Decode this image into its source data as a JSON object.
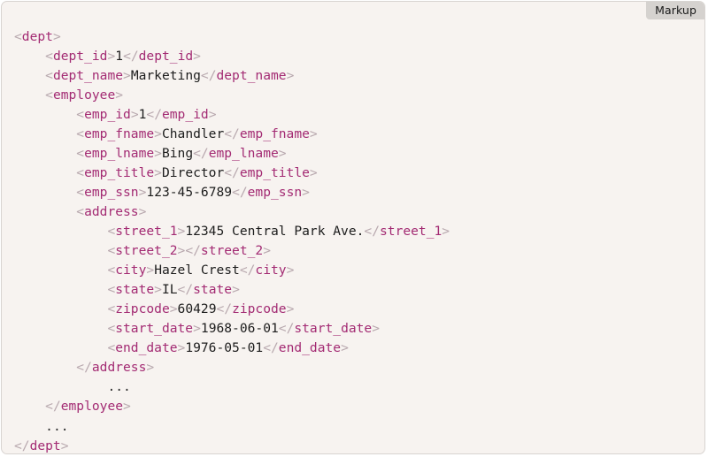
{
  "panel": {
    "tab_label": "Markup",
    "language": "xml",
    "background_color": "#f7f3f0",
    "border_color": "#d8d4d1",
    "tab_background_color": "#d5d2cf",
    "bracket_color": "#b8a8ae",
    "tag_name_color": "#a32b73",
    "text_value_color": "#1c1c1c"
  },
  "code": {
    "lines": [
      {
        "indent": 0,
        "type": "open",
        "tag": "dept"
      },
      {
        "indent": 1,
        "type": "element",
        "tag": "dept_id",
        "value": "1"
      },
      {
        "indent": 1,
        "type": "element",
        "tag": "dept_name",
        "value": "Marketing"
      },
      {
        "indent": 1,
        "type": "open",
        "tag": "employee"
      },
      {
        "indent": 2,
        "type": "element",
        "tag": "emp_id",
        "value": "1"
      },
      {
        "indent": 2,
        "type": "element",
        "tag": "emp_fname",
        "value": "Chandler"
      },
      {
        "indent": 2,
        "type": "element",
        "tag": "emp_lname",
        "value": "Bing"
      },
      {
        "indent": 2,
        "type": "element",
        "tag": "emp_title",
        "value": "Director"
      },
      {
        "indent": 2,
        "type": "element",
        "tag": "emp_ssn",
        "value": "123-45-6789"
      },
      {
        "indent": 2,
        "type": "open",
        "tag": "address"
      },
      {
        "indent": 3,
        "type": "element",
        "tag": "street_1",
        "value": "12345 Central Park Ave."
      },
      {
        "indent": 3,
        "type": "element",
        "tag": "street_2",
        "value": ""
      },
      {
        "indent": 3,
        "type": "element",
        "tag": "city",
        "value": "Hazel Crest"
      },
      {
        "indent": 3,
        "type": "element",
        "tag": "state",
        "value": "IL"
      },
      {
        "indent": 3,
        "type": "element",
        "tag": "zipcode",
        "value": "60429"
      },
      {
        "indent": 3,
        "type": "element",
        "tag": "start_date",
        "value": "1968-06-01"
      },
      {
        "indent": 3,
        "type": "element",
        "tag": "end_date",
        "value": "1976-05-01"
      },
      {
        "indent": 2,
        "type": "close",
        "tag": "address"
      },
      {
        "indent": 3,
        "type": "ellipsis",
        "text": "..."
      },
      {
        "indent": 1,
        "type": "close",
        "tag": "employee"
      },
      {
        "indent": 1,
        "type": "ellipsis",
        "text": "..."
      },
      {
        "indent": 0,
        "type": "close",
        "tag": "dept"
      }
    ]
  }
}
